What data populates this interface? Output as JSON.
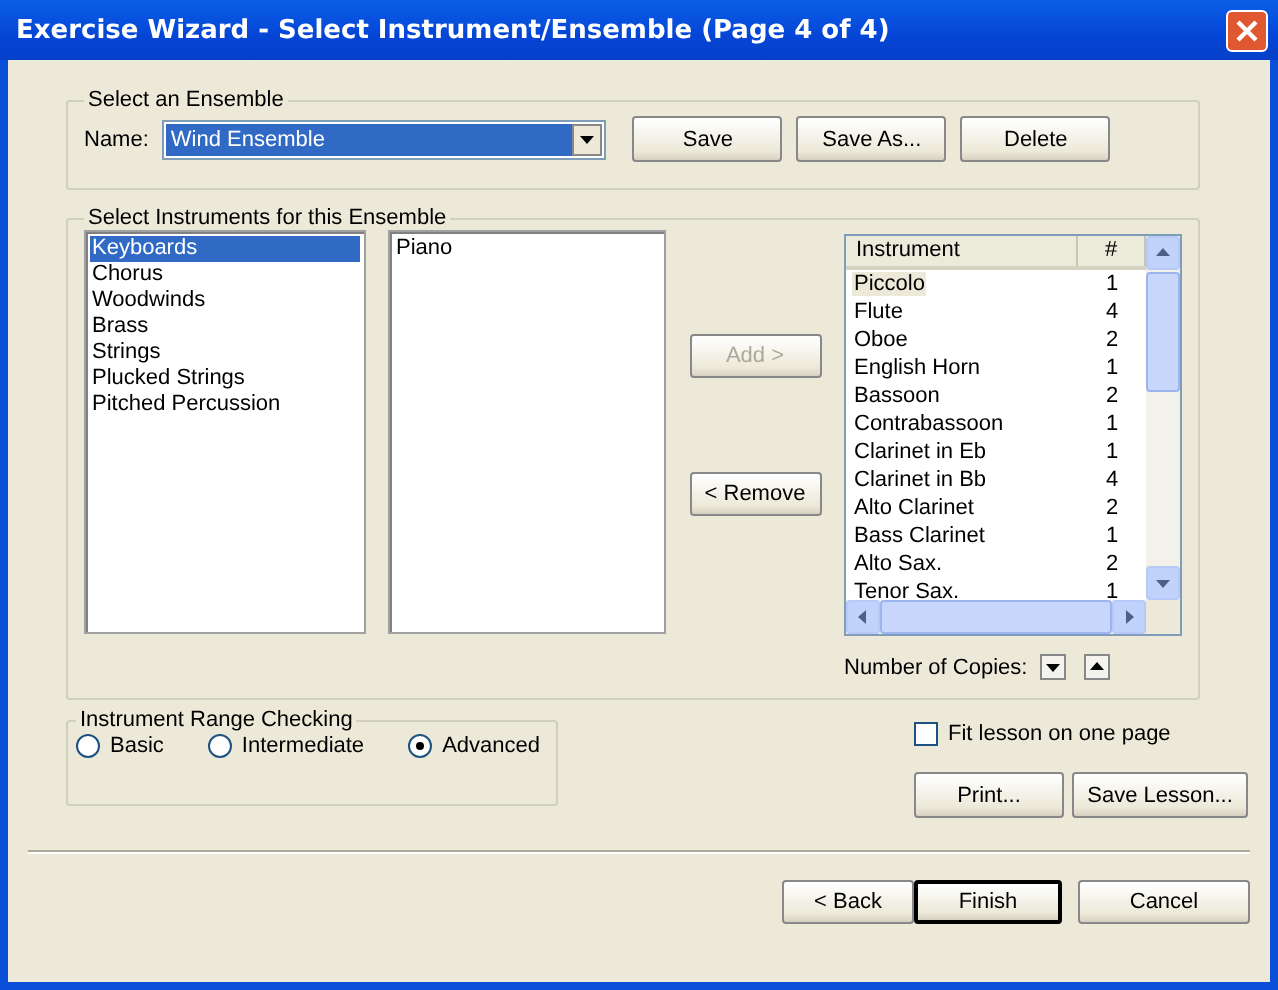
{
  "window": {
    "title": "Exercise Wizard - Select Instrument/Ensemble (Page 4 of 4)"
  },
  "ensemble_group": {
    "legend": "Select an Ensemble",
    "name_label": "Name:",
    "name_value": "Wind Ensemble",
    "buttons": [
      "Save",
      "Save As...",
      "Delete"
    ]
  },
  "instruments_group": {
    "legend": "Select Instruments for this Ensemble",
    "categories": [
      {
        "label": "Keyboards",
        "selected": true
      },
      {
        "label": "Chorus",
        "selected": false
      },
      {
        "label": "Woodwinds",
        "selected": false
      },
      {
        "label": "Brass",
        "selected": false
      },
      {
        "label": "Strings",
        "selected": false
      },
      {
        "label": "Plucked Strings",
        "selected": false
      },
      {
        "label": "Pitched Percussion",
        "selected": false
      }
    ],
    "members": [
      "Piano"
    ],
    "add_button": {
      "label": "Add >",
      "disabled": true
    },
    "remove_button": {
      "label": "< Remove",
      "disabled": false
    },
    "table": {
      "columns": [
        "Instrument",
        "#"
      ],
      "rows": [
        {
          "instrument": "Piccolo",
          "count": "1",
          "selected": true
        },
        {
          "instrument": "Flute",
          "count": "4",
          "selected": false
        },
        {
          "instrument": "Oboe",
          "count": "2",
          "selected": false
        },
        {
          "instrument": "English Horn",
          "count": "1",
          "selected": false
        },
        {
          "instrument": "Bassoon",
          "count": "2",
          "selected": false
        },
        {
          "instrument": "Contrabassoon",
          "count": "1",
          "selected": false
        },
        {
          "instrument": "Clarinet in Eb",
          "count": "1",
          "selected": false
        },
        {
          "instrument": "Clarinet in Bb",
          "count": "4",
          "selected": false
        },
        {
          "instrument": "Alto Clarinet",
          "count": "2",
          "selected": false
        },
        {
          "instrument": "Bass Clarinet",
          "count": "1",
          "selected": false
        },
        {
          "instrument": "Alto Sax.",
          "count": "2",
          "selected": false
        },
        {
          "instrument": "Tenor Sax.",
          "count": "1",
          "selected": false
        }
      ]
    },
    "copies_label": "Number of Copies:"
  },
  "range_group": {
    "legend": "Instrument Range Checking",
    "options": [
      {
        "label": "Basic",
        "selected": false
      },
      {
        "label": "Intermediate",
        "selected": false
      },
      {
        "label": "Advanced",
        "selected": true
      }
    ]
  },
  "fit_checkbox": {
    "label": "Fit lesson on one page",
    "checked": false
  },
  "lesson_buttons": [
    "Print...",
    "Save Lesson..."
  ],
  "nav_buttons": [
    {
      "label": "< Back",
      "default": false
    },
    {
      "label": "Finish",
      "default": true
    },
    {
      "label": "Cancel",
      "default": false
    }
  ]
}
